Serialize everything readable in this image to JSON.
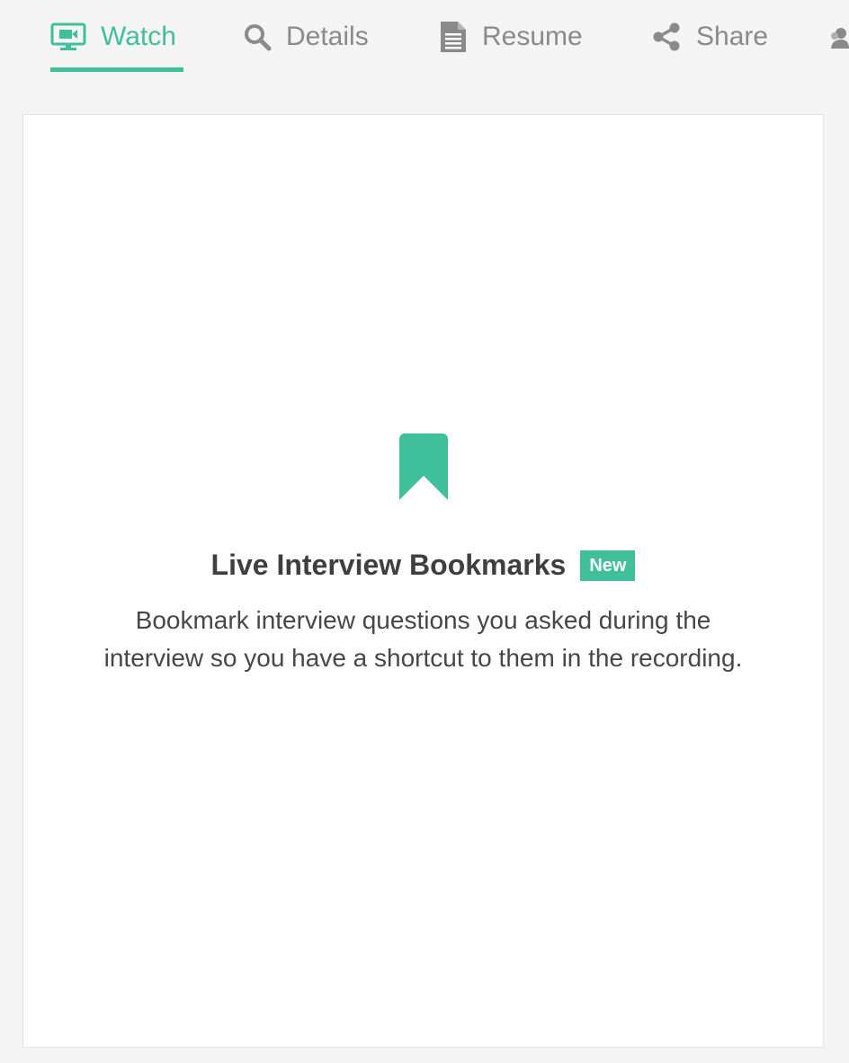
{
  "tabs": [
    {
      "label": "Watch",
      "icon": "monitor-video-icon",
      "active": true
    },
    {
      "label": "Details",
      "icon": "search-icon",
      "active": false
    },
    {
      "label": "Resume",
      "icon": "document-icon",
      "active": false
    },
    {
      "label": "Share",
      "icon": "share-icon",
      "active": false
    },
    {
      "label": "",
      "icon": "people-icon",
      "active": false
    }
  ],
  "colors": {
    "accent": "#40bf9b",
    "tab_inactive": "#8a8a8a",
    "background": "#f4f4f4",
    "card": "#ffffff"
  },
  "empty_state": {
    "icon": "bookmark-icon",
    "title": "Live Interview Bookmarks",
    "badge": "New",
    "description": "Bookmark interview questions you asked during the interview so you have a shortcut to them in the recording."
  }
}
